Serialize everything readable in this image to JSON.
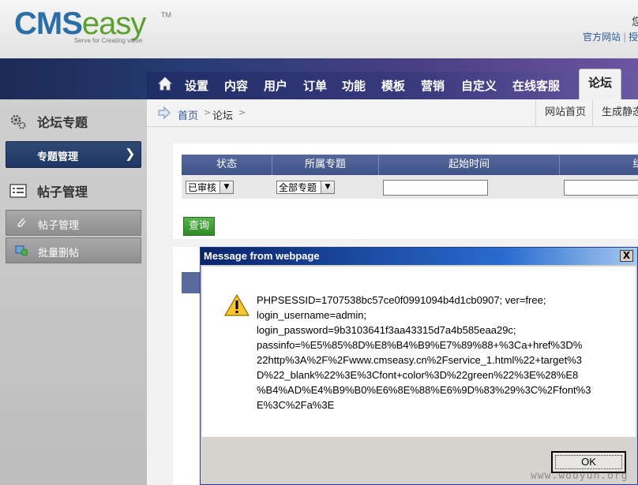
{
  "header": {
    "logo_cms": "CMS",
    "logo_easy": "easy",
    "logo_tm": "TM",
    "logo_tagline": "Serve for Creating value",
    "user_text": "您",
    "links": [
      "官方网站",
      "授"
    ]
  },
  "nav": {
    "items": [
      "设置",
      "内容",
      "用户",
      "订单",
      "功能",
      "模板",
      "营销",
      "自定义",
      "在线客服"
    ],
    "active": "论坛"
  },
  "sidebar": {
    "section1_title": "论坛专题",
    "active_item": "专题管理",
    "section2_title": "帖子管理",
    "items": [
      "帖子管理",
      "批量删帖"
    ]
  },
  "breadcrumb": {
    "home": "首页",
    "current": "论坛",
    "buttons": [
      "网站首页",
      "生成静态"
    ]
  },
  "filter": {
    "headers": [
      "状态",
      "所属专题",
      "起始时间",
      "结"
    ],
    "status_value": "已审核",
    "topic_value": "全部专题",
    "query_label": "查询"
  },
  "dialog": {
    "title": "Message from webpage",
    "close": "X",
    "message_lines": [
      "PHPSESSID=1707538bc57ce0f0991094b4d1cb0907; ver=free;",
      "login_username=admin;",
      "login_password=9b3103641f3aa43315d7a4b585eaa29c;",
      "passinfo=%E5%85%8D%E8%B4%B9%E7%89%88+%3Ca+href%3D%",
      "22http%3A%2F%2Fwww.cmseasy.cn%2Fservice_1.html%22+target%3",
      "D%22_blank%22%3E%3Cfont+color%3D%22green%22%3E%28%E8",
      "%B4%AD%E4%B9%B0%E6%8E%88%E6%9D%83%29%3C%2Ffont%3",
      "E%3C%2Fa%3E"
    ],
    "ok_label": "OK"
  },
  "watermark": "www.wooyun.org",
  "colors": {
    "nav_dark": "#1f2e66",
    "sidebar_active": "#2a3f6c",
    "dialog_title": "#0a246a",
    "query_button": "#3a9a2e"
  }
}
